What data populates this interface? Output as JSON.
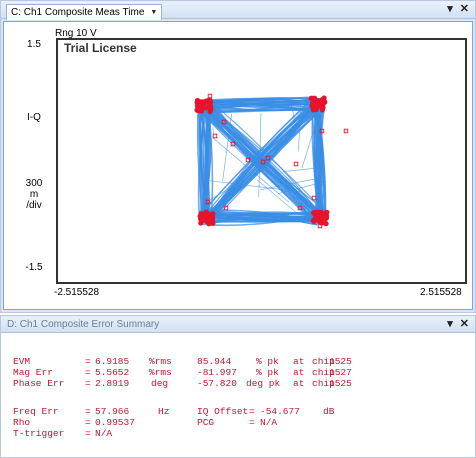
{
  "top_window": {
    "tab_label": "C: Ch1 Composite Meas Time",
    "dropdown_glyph": "▼",
    "pin_glyph": "▾",
    "close_glyph": "✕",
    "range_label": "Rng 10 V",
    "watermark": "Trial License",
    "y_axis": {
      "top": "1.5",
      "label": "I-Q",
      "scale_value": "300",
      "scale_unit_1": "m",
      "scale_unit_2": "/div",
      "bottom": "-1.5"
    },
    "x_axis": {
      "left": "-2.515528",
      "right": "2.515528"
    }
  },
  "bottom_window": {
    "title": "D: Ch1 Composite Error Summary",
    "pin_glyph": "▾",
    "close_glyph": "✕",
    "rows": [
      {
        "name": "EVM",
        "eq": "=",
        "value": "6.9185",
        "unit": "%rms",
        "pk_value": "85.944",
        "pk_unit": "% pk",
        "at": "at",
        "chip": "chip",
        "chip_no": "1525"
      },
      {
        "name": "Mag Err",
        "eq": "=",
        "value": "5.5652",
        "unit": "%rms",
        "pk_value": "-81.997",
        "pk_unit": "% pk",
        "at": "at",
        "chip": "chip",
        "chip_no": "1527"
      },
      {
        "name": "Phase Err",
        "eq": "=",
        "value": "2.8919",
        "unit": "deg",
        "pk_value": "-57.820",
        "pk_unit": "deg pk",
        "at": "at",
        "chip": "chip",
        "chip_no": "1525"
      }
    ],
    "freq_err": {
      "name": "Freq Err",
      "eq": "=",
      "value": "57.966",
      "unit": "Hz"
    },
    "iq_offset": {
      "name": "IQ Offset",
      "eq": "=",
      "value": "-54.677",
      "unit": "dB"
    },
    "rho": {
      "name": "Rho",
      "eq": "=",
      "value": "0.99537"
    },
    "pcg": {
      "name": "PCG",
      "eq": "=",
      "value": "N/A"
    },
    "t_trigger": {
      "name": "T-trigger",
      "eq": "=",
      "value": "N/A"
    }
  },
  "colors": {
    "trace_blue": "#3a8ee6",
    "marker_red": "#e8132a",
    "summary_text": "#c0162e",
    "window_frame": "#d9e6f5"
  }
}
